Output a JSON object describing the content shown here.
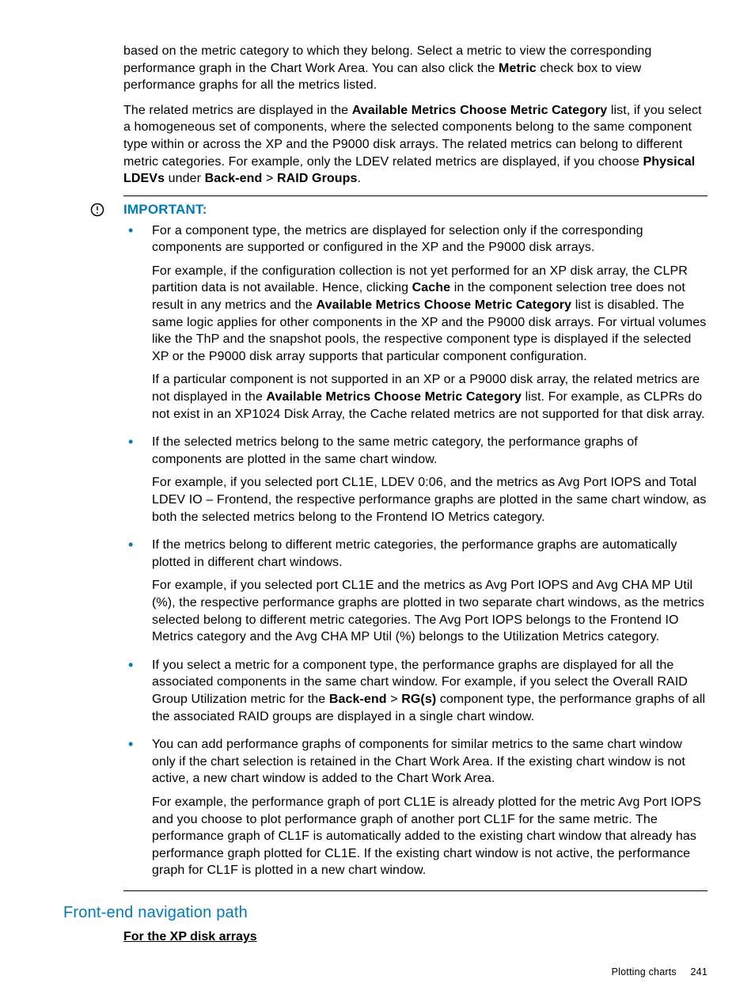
{
  "intro": {
    "p1_a": "based on the metric category to which they belong. Select a metric to view the corresponding performance graph in the Chart Work Area. You can also click the ",
    "p1_b": "Metric",
    "p1_c": " check box to view performance graphs for all the metrics listed.",
    "p2_a": "The related metrics are displayed in the ",
    "p2_b": "Available Metrics Choose Metric Category",
    "p2_c": " list, if you select a homogeneous set of components, where the selected components belong to the same component type within or across the XP and the P9000 disk arrays. The related metrics can belong to different metric categories. For example, only the LDEV related metrics are displayed, if you choose ",
    "p2_d": "Physical LDEVs",
    "p2_e": " under ",
    "p2_f": "Back-end",
    "p2_g": " > ",
    "p2_h": "RAID Groups",
    "p2_i": "."
  },
  "important": {
    "label": "IMPORTANT:",
    "items": [
      {
        "p1": "For a component type, the metrics are displayed for selection only if the corresponding components are supported or configured in the XP and the P9000 disk arrays.",
        "p2_a": "For example, if the configuration collection is not yet performed for an XP disk array, the CLPR partition data is not available. Hence, clicking ",
        "p2_b": "Cache",
        "p2_c": " in the component selection tree does not result in any metrics and the ",
        "p2_d": "Available Metrics Choose Metric Category",
        "p2_e": " list is disabled. The same logic applies for other components in the XP and the P9000 disk arrays. For virtual volumes like the ThP and the snapshot pools, the respective component type is displayed if the selected XP or the P9000 disk array supports that particular component configuration.",
        "p3_a": "If a particular component is not supported in an XP or a P9000 disk array, the related metrics are not displayed in the ",
        "p3_b": "Available Metrics Choose Metric Category",
        "p3_c": " list. For example, as CLPRs do not exist in an XP1024 Disk Array, the Cache related metrics are not supported for that disk array."
      },
      {
        "p1": "If the selected metrics belong to the same metric category, the performance graphs of components are plotted in the same chart window.",
        "p2": "For example, if you selected port CL1E, LDEV 0:06, and the metrics as Avg Port IOPS and Total LDEV IO – Frontend, the respective performance graphs are plotted in the same chart window, as both the selected metrics belong to the Frontend IO Metrics category."
      },
      {
        "p1": "If the metrics belong to different metric categories, the performance graphs are automatically plotted in different chart windows.",
        "p2": "For example, if you selected port CL1E and the metrics as Avg Port IOPS and Avg CHA MP Util (%), the respective performance graphs are plotted in two separate chart windows, as the metrics selected belong to different metric categories. The Avg Port IOPS belongs to the Frontend IO Metrics category and the Avg CHA MP Util (%) belongs to the Utilization Metrics category."
      },
      {
        "p1_a": "If you select a metric for a component type, the performance graphs are displayed for all the associated components in the same chart window. For example, if you select the Overall RAID Group Utilization metric for the ",
        "p1_b": "Back-end",
        "p1_c": " > ",
        "p1_d": "RG(s)",
        "p1_e": " component type, the performance graphs of all the associated RAID groups are displayed in a single chart window."
      },
      {
        "p1": "You can add performance graphs of components for similar metrics to the same chart window only if the chart selection is retained in the Chart Work Area. If the existing chart window is not active, a new chart window is added to the Chart Work Area.",
        "p2": "For example, the performance graph of port CL1E is already plotted for the metric Avg Port IOPS and you choose to plot performance graph of another port CL1F for the same metric. The performance graph of CL1F is automatically added to the existing chart window that already has performance graph plotted for CL1E. If the existing chart window is not active, the performance graph for CL1F is plotted in a new chart window."
      }
    ]
  },
  "section": {
    "title": "Front-end navigation path",
    "subhead": "For the XP disk arrays"
  },
  "footer": {
    "label": "Plotting charts",
    "page": "241"
  }
}
